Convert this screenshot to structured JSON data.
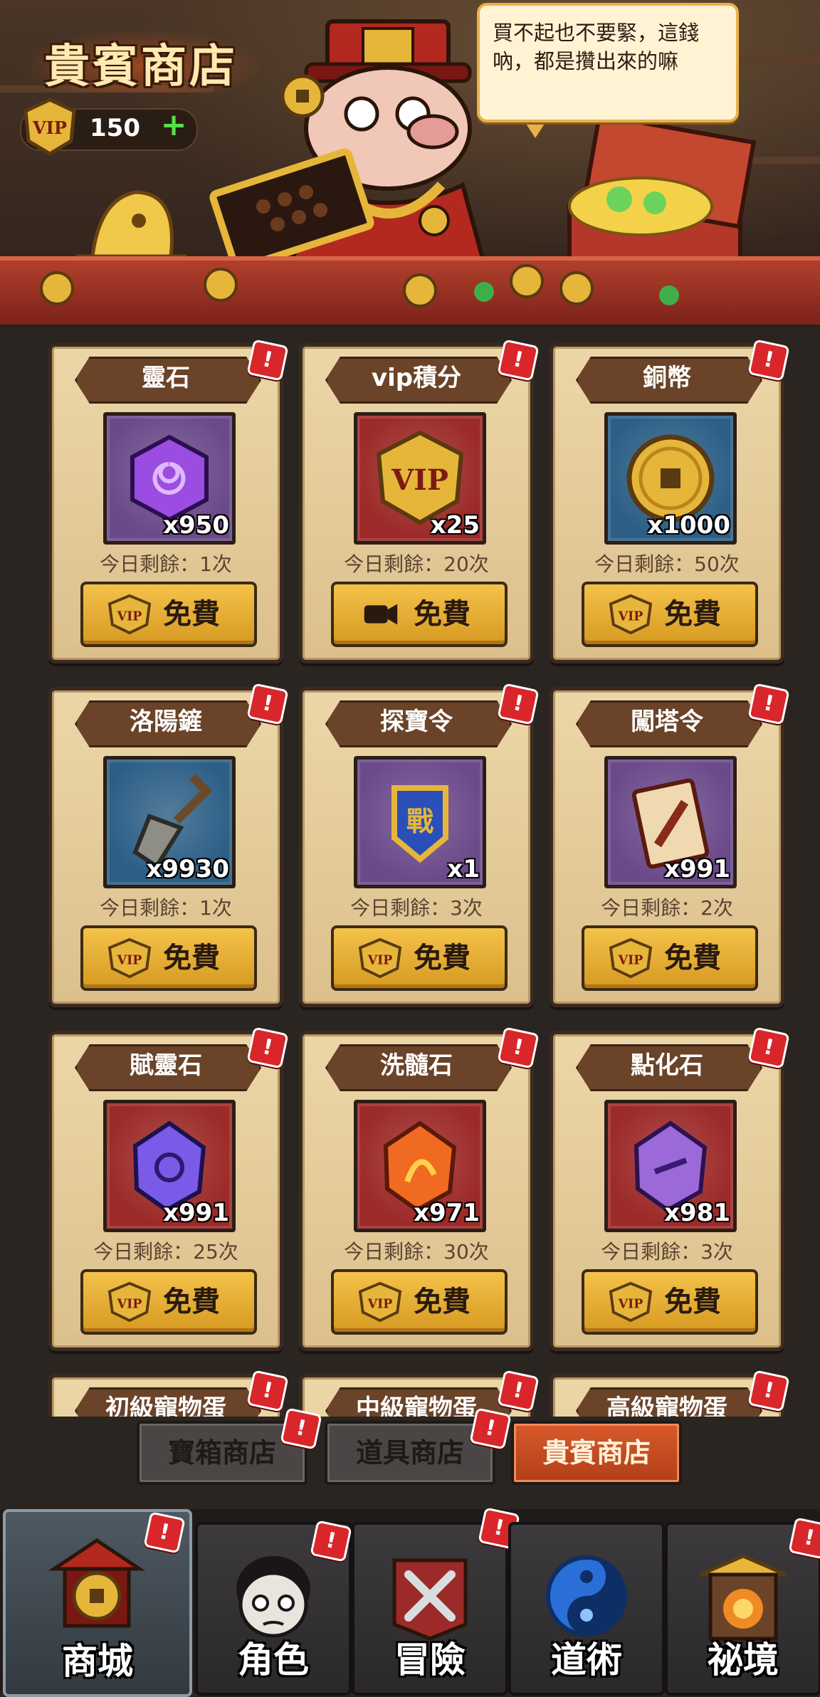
{
  "header": {
    "shop_title": "貴賓商店",
    "vip_points": "150",
    "vip_badge": "VIP",
    "add_symbol": "+",
    "speech": "買不起也不要緊，這錢吶，都是攢出來的嘛"
  },
  "cards": [
    {
      "name": "靈石",
      "qty": "x950",
      "remain": "今日剩餘：1次",
      "btn": "免費",
      "btn_icon": "vip-icon",
      "bg": "#6b4a8a",
      "item": "spirit-stone-icon"
    },
    {
      "name": "vip積分",
      "qty": "x25",
      "remain": "今日剩餘：20次",
      "btn": "免費",
      "btn_icon": "video-icon",
      "bg": "#9c2a28",
      "item": "vip-badge-icon"
    },
    {
      "name": "銅幣",
      "qty": "x1000",
      "remain": "今日剩餘：50次",
      "btn": "免費",
      "btn_icon": "vip-icon",
      "bg": "#2d5f86",
      "item": "copper-coin-icon"
    },
    {
      "name": "洛陽鏟",
      "qty": "x9930",
      "remain": "今日剩餘：1次",
      "btn": "免費",
      "btn_icon": "vip-icon",
      "bg": "#2d5f86",
      "item": "shovel-icon"
    },
    {
      "name": "探寶令",
      "qty": "x1",
      "remain": "今日剩餘：3次",
      "btn": "免費",
      "btn_icon": "vip-icon",
      "bg": "#6b4a8a",
      "item": "treasure-token-icon"
    },
    {
      "name": "闖塔令",
      "qty": "x991",
      "remain": "今日剩餘：2次",
      "btn": "免費",
      "btn_icon": "vip-icon",
      "bg": "#6b4a8a",
      "item": "tower-token-icon"
    },
    {
      "name": "賦靈石",
      "qty": "x991",
      "remain": "今日剩餘：25次",
      "btn": "免費",
      "btn_icon": "vip-icon",
      "bg": "#9c2a28",
      "item": "enchant-stone-icon"
    },
    {
      "name": "洗髓石",
      "qty": "x971",
      "remain": "今日剩餘：30次",
      "btn": "免費",
      "btn_icon": "vip-icon",
      "bg": "#9c2a28",
      "item": "marrow-stone-icon"
    },
    {
      "name": "點化石",
      "qty": "x981",
      "remain": "今日剩餘：3次",
      "btn": "免費",
      "btn_icon": "vip-icon",
      "bg": "#9c2a28",
      "item": "transmute-stone-icon"
    },
    {
      "name": "初級寵物蛋",
      "qty": "",
      "remain": "",
      "btn": "",
      "btn_icon": "",
      "bg": "#6b4a8a",
      "item": ""
    },
    {
      "name": "中級寵物蛋",
      "qty": "",
      "remain": "",
      "btn": "",
      "btn_icon": "",
      "bg": "#6b4a8a",
      "item": ""
    },
    {
      "name": "高級寵物蛋",
      "qty": "",
      "remain": "",
      "btn": "",
      "btn_icon": "",
      "bg": "#6b4a8a",
      "item": ""
    }
  ],
  "alert_mark": "!",
  "shop_tabs": [
    {
      "label": "寶箱商店",
      "active": false
    },
    {
      "label": "道具商店",
      "active": false
    },
    {
      "label": "貴賓商店",
      "active": true
    }
  ],
  "nav": [
    {
      "label": "商城",
      "active": true,
      "icon": "mall-pagoda-icon"
    },
    {
      "label": "角色",
      "active": false,
      "icon": "character-icon"
    },
    {
      "label": "冒險",
      "active": false,
      "icon": "crossed-swords-icon"
    },
    {
      "label": "道術",
      "active": false,
      "icon": "taiji-icon"
    },
    {
      "label": "祕境",
      "active": false,
      "icon": "secret-realm-gate-icon"
    }
  ],
  "colors": {
    "accent": "#d85a2c",
    "button_gold": "#f4c24a",
    "alert_red": "#d8262a",
    "plus_green": "#57e04a"
  }
}
